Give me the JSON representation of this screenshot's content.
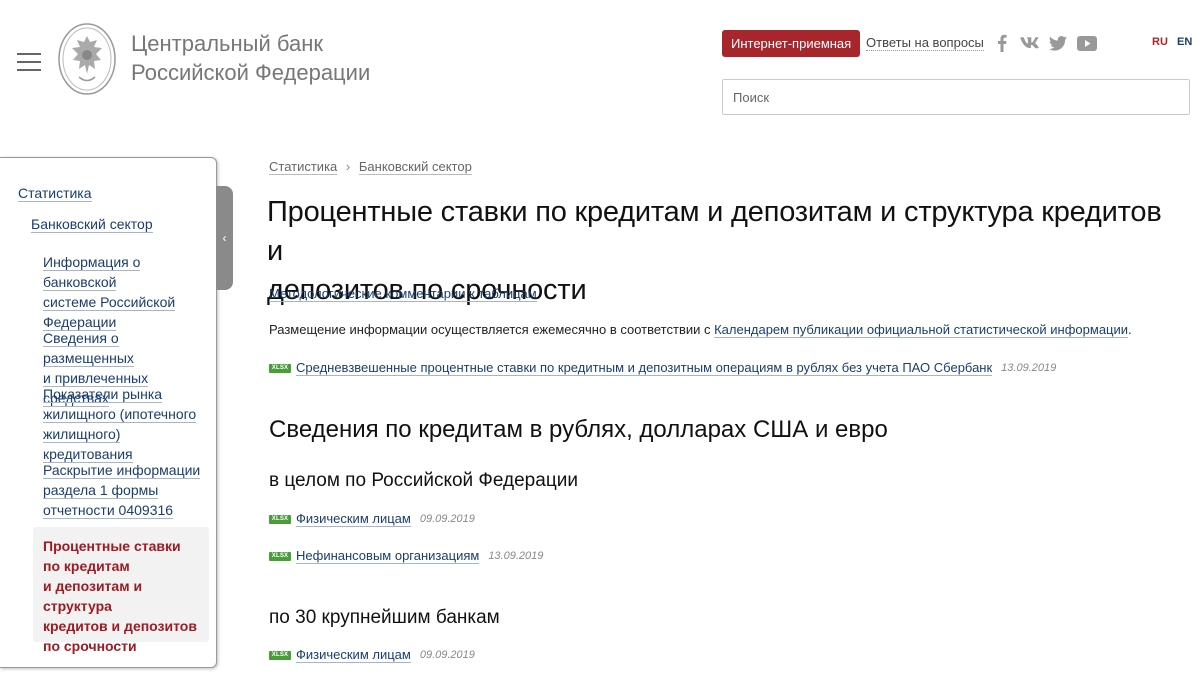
{
  "header": {
    "bank_name_line1": "Центральный банк",
    "bank_name_line2": "Российской Федерации",
    "reception_button": "Интернет-приемная",
    "faq_link": "Ответы на вопросы",
    "search_placeholder": "Поиск",
    "lang_ru": "RU",
    "lang_en": "EN",
    "social_icons": [
      "facebook-icon",
      "vk-icon",
      "twitter-icon",
      "youtube-icon"
    ]
  },
  "sidebar": {
    "root": "Статистика",
    "level2": "Банковский сектор",
    "items": [
      {
        "lines": [
          "Информация о банковской",
          "системе Российской",
          "Федерации"
        ]
      },
      {
        "lines": [
          "Сведения о размещенных",
          "и привлеченных средствах"
        ]
      },
      {
        "lines": [
          "Показатели рынка",
          "жилищного (ипотечного",
          "жилищного) кредитования"
        ]
      },
      {
        "lines": [
          "Раскрытие информации",
          "раздела 1 формы",
          "отчетности 0409316"
        ]
      }
    ],
    "active_lines": [
      "Процентные ставки",
      "по кредитам",
      "и депозитам и структура",
      "кредитов и депозитов",
      "по срочности"
    ]
  },
  "breadcrumb": {
    "level1": "Статистика",
    "level2": "Банковский сектор"
  },
  "main": {
    "title_line1": "Процентные ставки по кредитам и депозитам и структура кредитов и",
    "title_line2": "депозитов по срочности",
    "methodology_link": "Методологические комментарии к таблицам",
    "placement_text": "Размещение информации осуществляется ежемесячно в соответствии с ",
    "placement_link": "Календарем публикации официальной статистической информации",
    "placement_end": ".",
    "file_badge": "XLSX",
    "weighted_rates_link": "Средневзвешенные процентные ставки по кредитным и депозитным операциям в рублях без учета ПАО Сбербанк",
    "weighted_rates_date": "13.09.2019",
    "credits_heading": "Сведения по кредитам в рублях, долларах США и евро",
    "rf_heading": "в целом по Российской Федерации",
    "rf_individuals": "Физическим лицам",
    "rf_individuals_date": "09.09.2019",
    "rf_nonfinancial": "Нефинансовым организациям",
    "rf_nonfinancial_date": "13.09.2019",
    "banks30_heading": "по 30 крупнейшим банкам",
    "banks30_individuals": "Физическим лицам",
    "banks30_individuals_date": "09.09.2019"
  },
  "colors": {
    "brand_red": "#a6262c",
    "link_blue": "#1a3e6e",
    "xlsx_green": "#4a9e3a"
  }
}
